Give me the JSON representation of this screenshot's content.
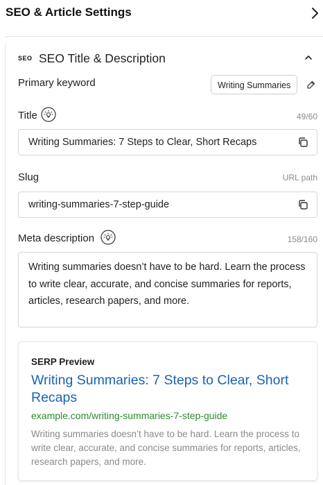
{
  "header": {
    "title": "SEO & Article Settings"
  },
  "section": {
    "badge": "SEO",
    "title": "SEO Title & Description"
  },
  "keyword": {
    "label": "Primary keyword",
    "value": "Writing Summaries"
  },
  "title_field": {
    "label": "Title",
    "count": "49/60",
    "value": "Writing Summaries: 7 Steps to Clear, Short Recaps"
  },
  "slug_field": {
    "label": "Slug",
    "hint": "URL path",
    "value": "writing-summaries-7-step-guide"
  },
  "meta_field": {
    "label": "Meta description",
    "count": "158/160",
    "value": "Writing summaries doesn’t have to be hard. Learn the process to write clear, accurate, and concise summaries for reports, articles, research papers, and more."
  },
  "serp": {
    "label": "SERP Preview",
    "title": "Writing Summaries: 7 Steps to Clear, Short Recaps",
    "url": "example.com/writing-summaries-7-step-guide",
    "description": "Writing summaries doesn’t have to be hard. Learn the process to write clear, accurate, and concise summaries for reports, articles, research papers, and more."
  },
  "colors": {
    "link": "#1a62b0",
    "url": "#2d8a2e",
    "muted": "#8a8a8a",
    "border": "#d6d6d6"
  },
  "icons": [
    "chevron-right-icon",
    "chevron-up-icon",
    "lightbulb-icon",
    "edit-icon",
    "copy-icon"
  ]
}
